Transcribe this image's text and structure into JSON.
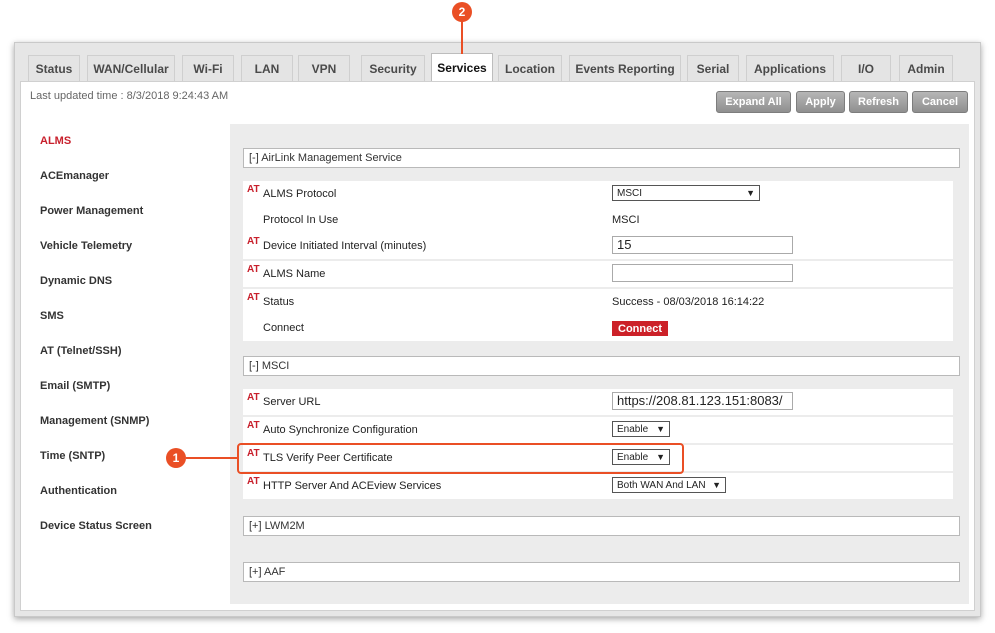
{
  "tabs": [
    "Status",
    "WAN/Cellular",
    "Wi-Fi",
    "LAN",
    "VPN",
    "Security",
    "Services",
    "Location",
    "Events Reporting",
    "Serial",
    "Applications",
    "I/O",
    "Admin"
  ],
  "active_tab": "Services",
  "last_updated": "Last updated time : 8/3/2018 9:24:43 AM",
  "buttons": {
    "expand_all": "Expand All",
    "apply": "Apply",
    "refresh": "Refresh",
    "cancel": "Cancel"
  },
  "sidebar": {
    "items": [
      "ALMS",
      "ACEmanager",
      "Power Management",
      "Vehicle Telemetry",
      "Dynamic DNS",
      "SMS",
      "AT (Telnet/SSH)",
      "Email (SMTP)",
      "Management (SNMP)",
      "Time (SNTP)",
      "Authentication",
      "Device Status Screen"
    ],
    "active": "ALMS"
  },
  "at_label": "AT",
  "sections": {
    "airlink": "[-] AirLink Management Service",
    "msci": "[-] MSCI",
    "lwm2m": "[+] LWM2M",
    "aaf": "[+] AAF"
  },
  "airlink_rows": {
    "alms_protocol": {
      "label": "ALMS Protocol",
      "value": "MSCI"
    },
    "protocol_in_use": {
      "label": "Protocol In Use",
      "value": "MSCI"
    },
    "interval": {
      "label": "Device Initiated Interval (minutes)",
      "value": "15"
    },
    "alms_name": {
      "label": "ALMS Name",
      "value": ""
    },
    "status": {
      "label": "Status",
      "value": "Success - 08/03/2018 16:14:22"
    },
    "connect": {
      "label": "Connect",
      "button": "Connect"
    }
  },
  "msci_rows": {
    "server_url": {
      "label": "Server URL",
      "value": "https://208.81.123.151:8083/"
    },
    "auto_sync": {
      "label": "Auto Synchronize Configuration",
      "value": "Enable"
    },
    "tls_verify": {
      "label": "TLS Verify Peer Certificate",
      "value": "Enable"
    },
    "http_server": {
      "label": "HTTP Server And ACEview Services",
      "value": "Both WAN And LAN"
    }
  },
  "callouts": [
    "1",
    "2"
  ],
  "colors": {
    "accent_red": "#c8202c",
    "callout_orange": "#ea4f25",
    "button_gray": "#9a9a9a"
  }
}
